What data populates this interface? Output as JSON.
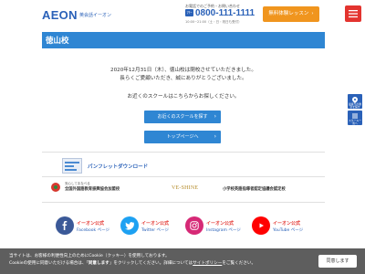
{
  "header": {
    "logo": "AEON",
    "logo_sub": "英会話イーオン",
    "tel_note": "お電話でのご予約・お問い合わせ",
    "tel_badge": "ﾌﾘｰ",
    "tel_number": "0800-111-1111",
    "tel_hours": "10:00~21:00（土・日・祝日も受付）",
    "trial_button": "無料体験レッスン",
    "menu_icon": "hamburger-icon"
  },
  "page": {
    "title": "徳山校"
  },
  "message": {
    "line1": "2020年12月31日（木）、徳山校は閉校させていただきました。",
    "line2": "長らくご愛顧いただき、誠にありがとうございました。",
    "line3": "お近くのスクールはこちらからお探しください。"
  },
  "buttons": {
    "find_school": "お近くのスクールを探す",
    "top_page": "トップページへ"
  },
  "side_buttons": [
    {
      "label": "最寄りの教室を探す",
      "icon": "map-pin-icon"
    },
    {
      "label": "スクール一覧へ",
      "icon": "list-icon"
    }
  ],
  "pamphlet": {
    "link": "パンフレットダウンロード"
  },
  "associations": {
    "assoc1_small": "安心してまなべる",
    "assoc1_name": "全国外国語教育振興協会加盟校",
    "vshine_logo": "VE-SHINE",
    "assoc2_name": "小学校英語指導者認定協議会認定校"
  },
  "social": [
    {
      "line1": "イーオン公式",
      "line2": "Facebook ページ",
      "icon": "facebook-icon",
      "color": "#3b5998"
    },
    {
      "line1": "イーオン公式",
      "line2": "Twitter ページ",
      "icon": "twitter-icon",
      "color": "#1da1f2"
    },
    {
      "line1": "イーオン公式",
      "line2": "Instagram ページ",
      "icon": "instagram-icon",
      "color": "#d62976"
    },
    {
      "line1": "イーオン公式",
      "line2": "YouTube ページ",
      "icon": "youtube-icon",
      "color": "#ff0000"
    }
  ],
  "cookie": {
    "line1_pre": "当サイトは、お客様の利便性向上のためにCookie（クッキー）を使用しております。",
    "line2_pre": "Cookieの使用に同意いただける場合は、「",
    "line2_agree": "同意します",
    "line2_mid": "」をクリックしてください。詳細については",
    "line2_link": "サイトポリシー",
    "line2_post": "をご覧ください。",
    "button": "同意します"
  }
}
